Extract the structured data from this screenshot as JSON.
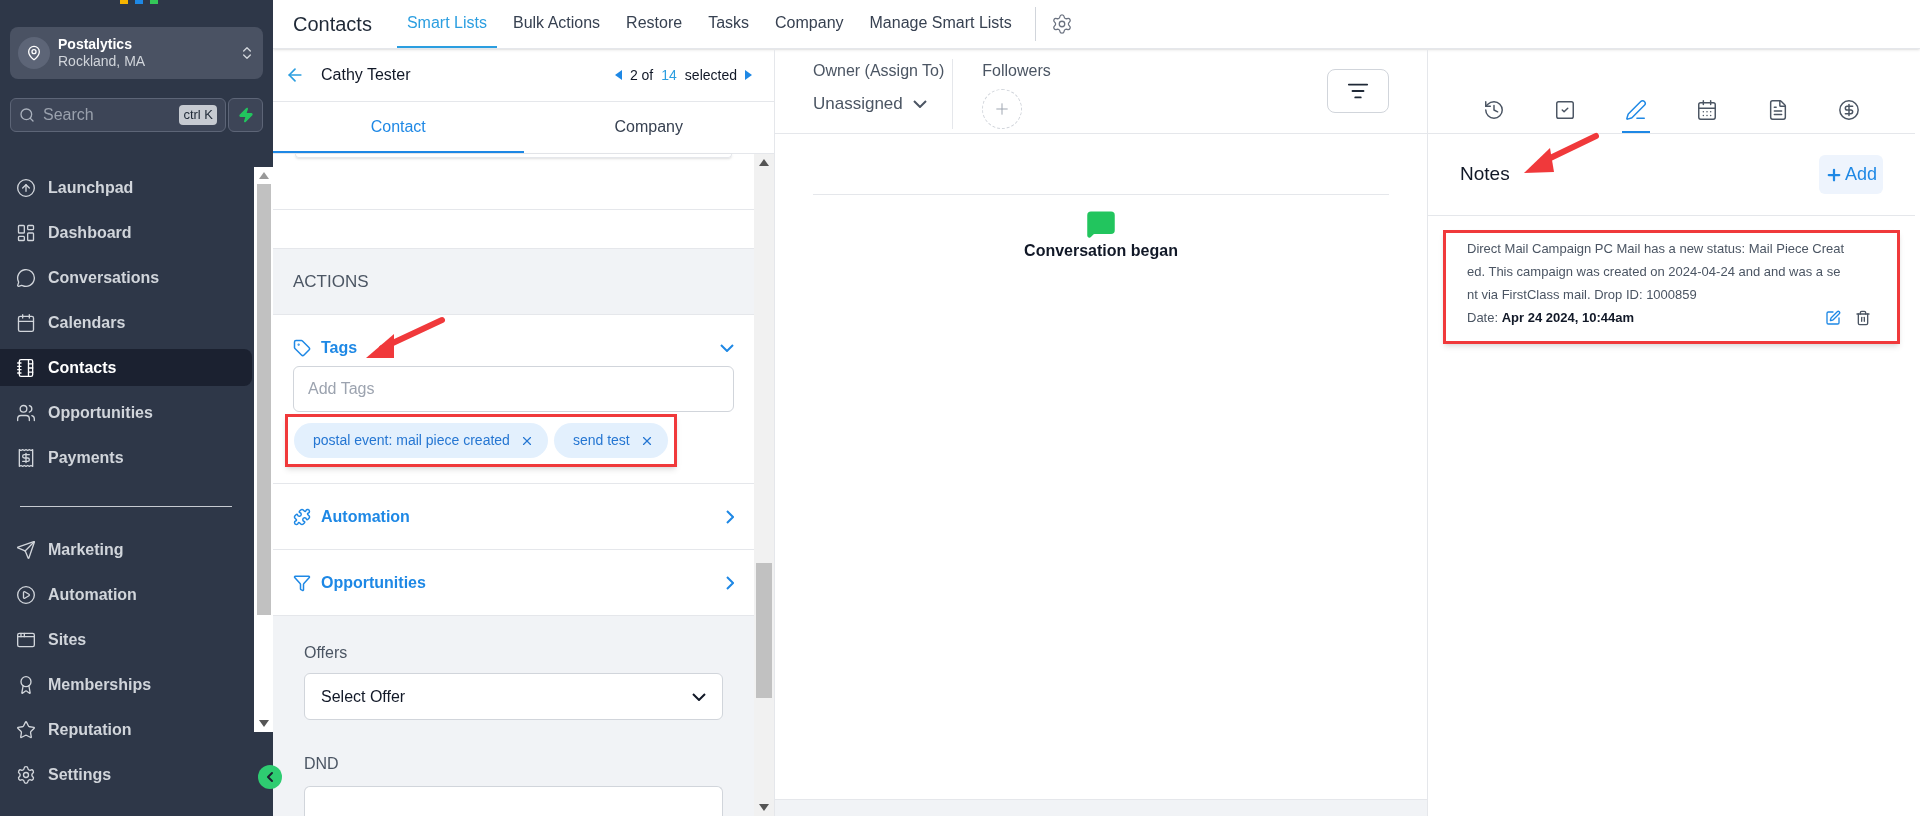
{
  "account": {
    "name": "Postalytics",
    "location": "Rockland, MA"
  },
  "search": {
    "placeholder": "Search",
    "shortcut": "ctrl K"
  },
  "nav_primary": [
    {
      "label": "Launchpad",
      "selected": false
    },
    {
      "label": "Dashboard",
      "selected": false
    },
    {
      "label": "Conversations",
      "selected": false
    },
    {
      "label": "Calendars",
      "selected": false
    },
    {
      "label": "Contacts",
      "selected": true
    },
    {
      "label": "Opportunities",
      "selected": false
    },
    {
      "label": "Payments",
      "selected": false
    }
  ],
  "nav_secondary": [
    {
      "label": "Marketing",
      "selected": false
    },
    {
      "label": "Automation",
      "selected": false
    },
    {
      "label": "Sites",
      "selected": false
    },
    {
      "label": "Memberships",
      "selected": false
    },
    {
      "label": "Reputation",
      "selected": false
    }
  ],
  "settings": {
    "label": "Settings"
  },
  "top_nav": {
    "title": "Contacts",
    "tabs": [
      {
        "label": "Smart Lists",
        "selected": true
      },
      {
        "label": "Bulk Actions",
        "selected": false
      },
      {
        "label": "Restore",
        "selected": false
      },
      {
        "label": "Tasks",
        "selected": false
      },
      {
        "label": "Company",
        "selected": false
      },
      {
        "label": "Manage Smart Lists",
        "selected": false
      }
    ]
  },
  "contact_header": {
    "name": "Cathy Tester",
    "position": "2 of",
    "total": "14",
    "suffix": "selected"
  },
  "detail_tabs": [
    {
      "label": "Contact",
      "selected": true
    },
    {
      "label": "Company",
      "selected": false
    }
  ],
  "actions": {
    "heading": "ACTIONS",
    "sections": [
      {
        "label": "Tags",
        "expanded": true,
        "placeholder": "Add Tags",
        "tags": [
          "postal event: mail piece created",
          "send test"
        ]
      },
      {
        "label": "Automation",
        "expanded": false
      },
      {
        "label": "Opportunities",
        "expanded": false
      }
    ]
  },
  "offers": {
    "label": "Offers",
    "value": "Select Offer"
  },
  "dnd": {
    "label": "DND"
  },
  "owner": {
    "label": "Owner (Assign To)",
    "value": "Unassigned"
  },
  "followers": {
    "label": "Followers"
  },
  "timeline": [
    {
      "text": "Conversation began"
    }
  ],
  "activity_tabs": [
    {
      "kind": "history",
      "selected": false
    },
    {
      "kind": "tasks",
      "selected": false
    },
    {
      "kind": "notes",
      "selected": true
    },
    {
      "kind": "appointments",
      "selected": false
    },
    {
      "kind": "documents",
      "selected": false
    },
    {
      "kind": "payments",
      "selected": false
    }
  ],
  "notes": {
    "title": "Notes",
    "add_label": "Add",
    "items": [
      {
        "text": "Direct Mail Campaign PC Mail has a new status: Mail Piece Created. This campaign was created on 2024-04-24 and and was a sent via FirstClass mail. Drop ID: 1000859",
        "date_label": "Date:",
        "date": "Apr 24 2024, 10:44am"
      }
    ]
  }
}
